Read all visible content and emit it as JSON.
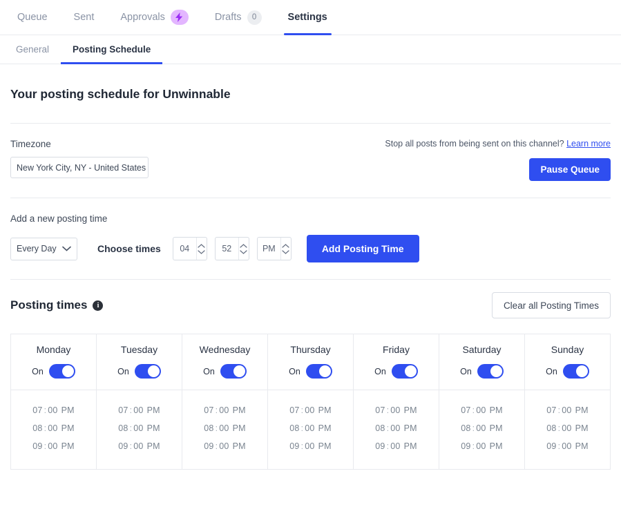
{
  "topnav": {
    "items": [
      {
        "label": "Queue",
        "active": false,
        "badge": null
      },
      {
        "label": "Sent",
        "active": false,
        "badge": null
      },
      {
        "label": "Approvals",
        "active": false,
        "badge": "bolt"
      },
      {
        "label": "Drafts",
        "active": false,
        "badge": "0"
      },
      {
        "label": "Settings",
        "active": true,
        "badge": null
      }
    ]
  },
  "subnav": {
    "items": [
      {
        "label": "General",
        "active": false
      },
      {
        "label": "Posting Schedule",
        "active": true
      }
    ]
  },
  "page": {
    "title": "Your posting schedule for Unwinnable"
  },
  "timezone": {
    "label": "Timezone",
    "value": "New York City, NY - United States",
    "note": "Stop all posts from being sent on this channel?",
    "learn_more": "Learn more",
    "pause_button": "Pause Queue"
  },
  "add_time": {
    "heading": "Add a new posting time",
    "frequency": "Every Day",
    "choose_times_label": "Choose times",
    "hour": "04",
    "minute": "52",
    "meridiem": "PM",
    "add_button": "Add Posting Time"
  },
  "posting_times": {
    "title": "Posting times",
    "info_char": "i",
    "clear_button": "Clear all Posting Times",
    "toggle_on_label": "On",
    "days": [
      {
        "name": "Monday",
        "on": true,
        "times": [
          {
            "hour": "07",
            "minute": "00",
            "meridiem": "PM"
          },
          {
            "hour": "08",
            "minute": "00",
            "meridiem": "PM"
          },
          {
            "hour": "09",
            "minute": "00",
            "meridiem": "PM"
          }
        ]
      },
      {
        "name": "Tuesday",
        "on": true,
        "times": [
          {
            "hour": "07",
            "minute": "00",
            "meridiem": "PM"
          },
          {
            "hour": "08",
            "minute": "00",
            "meridiem": "PM"
          },
          {
            "hour": "09",
            "minute": "00",
            "meridiem": "PM"
          }
        ]
      },
      {
        "name": "Wednesday",
        "on": true,
        "times": [
          {
            "hour": "07",
            "minute": "00",
            "meridiem": "PM"
          },
          {
            "hour": "08",
            "minute": "00",
            "meridiem": "PM"
          },
          {
            "hour": "09",
            "minute": "00",
            "meridiem": "PM"
          }
        ]
      },
      {
        "name": "Thursday",
        "on": true,
        "times": [
          {
            "hour": "07",
            "minute": "00",
            "meridiem": "PM"
          },
          {
            "hour": "08",
            "minute": "00",
            "meridiem": "PM"
          },
          {
            "hour": "09",
            "minute": "00",
            "meridiem": "PM"
          }
        ]
      },
      {
        "name": "Friday",
        "on": true,
        "times": [
          {
            "hour": "07",
            "minute": "00",
            "meridiem": "PM"
          },
          {
            "hour": "08",
            "minute": "00",
            "meridiem": "PM"
          },
          {
            "hour": "09",
            "minute": "00",
            "meridiem": "PM"
          }
        ]
      },
      {
        "name": "Saturday",
        "on": true,
        "times": [
          {
            "hour": "07",
            "minute": "00",
            "meridiem": "PM"
          },
          {
            "hour": "08",
            "minute": "00",
            "meridiem": "PM"
          },
          {
            "hour": "09",
            "minute": "00",
            "meridiem": "PM"
          }
        ]
      },
      {
        "name": "Sunday",
        "on": true,
        "times": [
          {
            "hour": "07",
            "minute": "00",
            "meridiem": "PM"
          },
          {
            "hour": "08",
            "minute": "00",
            "meridiem": "PM"
          },
          {
            "hour": "09",
            "minute": "00",
            "meridiem": "PM"
          }
        ]
      }
    ]
  },
  "colors": {
    "accent_blue": "#2f4ef0",
    "badge_purple": "#e3b6ff",
    "bolt_purple": "#9b2df5",
    "border": "#e8eaee",
    "text_dark": "#2b3445",
    "text_muted": "#8a93a5"
  }
}
